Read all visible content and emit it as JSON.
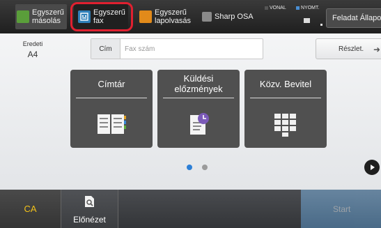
{
  "topbar": {
    "apps": [
      {
        "label": "Egyszerű\nmásolás",
        "icon": "copy-icon",
        "color": "#5a9e3a"
      },
      {
        "label": "Egyszerű\nfax",
        "icon": "fax-icon",
        "color": "#2f7fb8",
        "selected": true
      },
      {
        "label": "Egyszerű\nlapolvasás",
        "icon": "scan-icon",
        "color": "#e28a1a"
      },
      {
        "label": "Sharp OSA",
        "icon": "osa-icon",
        "color": "#8a8a8a"
      }
    ],
    "status_line": "VONAL",
    "status_print": "NYOMT.",
    "job_status_label": "Feladat Állapota"
  },
  "main": {
    "original_label": "Eredeti",
    "original_size": "A4",
    "address_button": "Cím",
    "fax_placeholder": "Fax szám",
    "detail_button": "Részlet.",
    "tiles": [
      {
        "label": "Címtár",
        "icon": "address-book-icon"
      },
      {
        "label": "Küldési\nelőzmények",
        "icon": "send-history-icon"
      },
      {
        "label": "Közv. Bevitel",
        "icon": "keypad-icon"
      }
    ],
    "page_indicator": {
      "pages": 2,
      "current": 1
    }
  },
  "bottom": {
    "ca_label": "CA",
    "preview_label": "Előnézet",
    "start_label": "Start"
  },
  "colors": {
    "accent": "#2c7fd6",
    "highlight": "#e02030",
    "ca_text": "#f3c21a"
  }
}
